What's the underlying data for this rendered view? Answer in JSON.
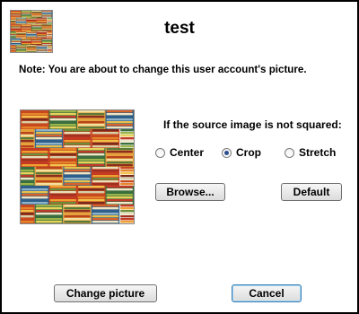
{
  "header": {
    "username": "test"
  },
  "note": "Note: You are about to change this user account's picture.",
  "crop_options": {
    "label": "If the source image is not squared:",
    "choices": [
      {
        "label": "Center",
        "checked": false
      },
      {
        "label": "Crop",
        "checked": true
      },
      {
        "label": "Stretch",
        "checked": false
      }
    ]
  },
  "buttons": {
    "browse": "Browse...",
    "default": "Default",
    "change_picture": "Change picture",
    "cancel": "Cancel"
  },
  "icons": {
    "picture": "woven-textile-image"
  }
}
